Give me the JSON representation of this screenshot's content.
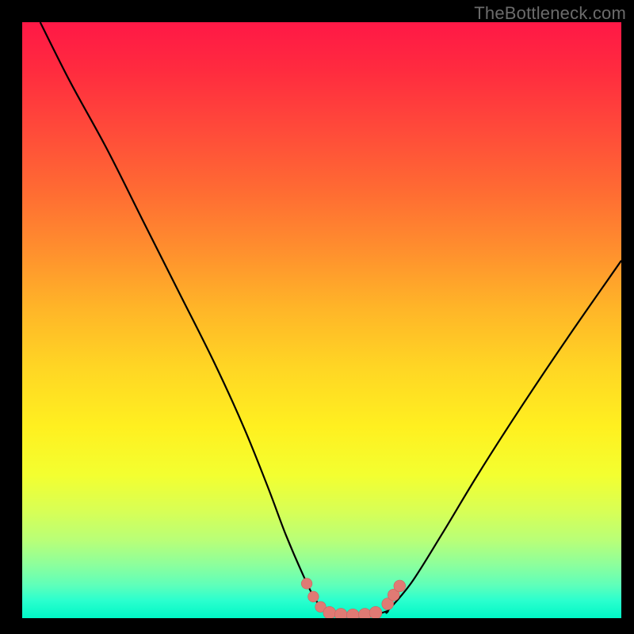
{
  "watermark": "TheBottleneck.com",
  "colors": {
    "frame_bg": "#000000",
    "curve": "#000000",
    "marker_fill": "#e07a74",
    "marker_stroke": "#c86560",
    "gradient_top": "#ff1846",
    "gradient_bottom": "#00f7c6"
  },
  "chart_data": {
    "type": "line",
    "title": "",
    "xlabel": "",
    "ylabel": "",
    "xlim": [
      0,
      100
    ],
    "ylim": [
      0,
      100
    ],
    "grid": false,
    "legend": false,
    "annotations": [
      "TheBottleneck.com"
    ],
    "series": [
      {
        "name": "left-branch",
        "x": [
          3,
          8,
          14,
          20,
          26,
          32,
          37,
          41,
          44,
          47,
          49,
          51
        ],
        "y": [
          100,
          90,
          79,
          67,
          55,
          43,
          32,
          22,
          14,
          7,
          3,
          1
        ]
      },
      {
        "name": "valley",
        "x": [
          51,
          53,
          55,
          57,
          59,
          61
        ],
        "y": [
          1,
          0.5,
          0.3,
          0.3,
          0.6,
          1.2
        ]
      },
      {
        "name": "right-branch",
        "x": [
          61,
          65,
          70,
          76,
          83,
          91,
          100
        ],
        "y": [
          1.2,
          6,
          14,
          24,
          35,
          47,
          60
        ]
      }
    ],
    "markers": [
      {
        "x": 47.5,
        "y": 5.8,
        "r": 1.2
      },
      {
        "x": 48.6,
        "y": 3.6,
        "r": 1.2
      },
      {
        "x": 49.8,
        "y": 1.9,
        "r": 1.2
      },
      {
        "x": 51.3,
        "y": 0.9,
        "r": 1.4
      },
      {
        "x": 53.2,
        "y": 0.6,
        "r": 1.4
      },
      {
        "x": 55.2,
        "y": 0.5,
        "r": 1.4
      },
      {
        "x": 57.2,
        "y": 0.6,
        "r": 1.4
      },
      {
        "x": 59.0,
        "y": 0.9,
        "r": 1.4
      },
      {
        "x": 61.0,
        "y": 2.4,
        "r": 1.3
      },
      {
        "x": 62.0,
        "y": 3.9,
        "r": 1.3
      },
      {
        "x": 63.0,
        "y": 5.4,
        "r": 1.3
      }
    ]
  }
}
